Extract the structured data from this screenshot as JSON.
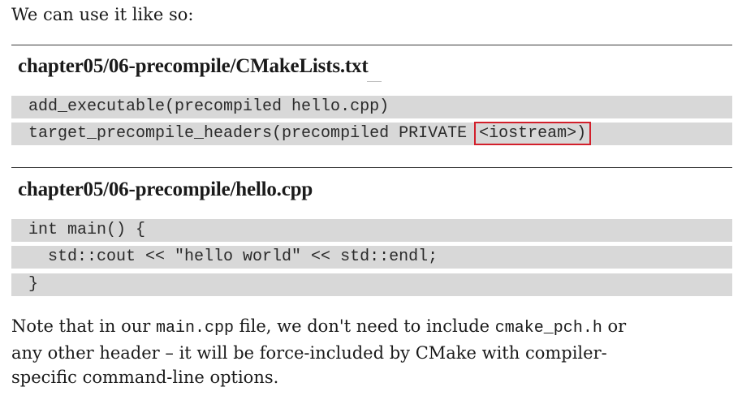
{
  "intro": "We can use it like so:",
  "section1": {
    "title": "chapter05/06-precompile/CMakeLists.txt",
    "lines": [
      "add_executable(precompiled hello.cpp)",
      "target_precompile_headers(precompiled PRIVATE "
    ],
    "highlight": "<iostream>)"
  },
  "section2": {
    "title": "chapter05/06-precompile/hello.cpp",
    "lines": [
      "int main() {",
      "  std::cout << \"hello world\" << std::endl;",
      "}"
    ]
  },
  "note": {
    "part1": "Note that in our ",
    "code1": "main.cpp",
    "part2": " file, we don't need to include ",
    "code2": "cmake_pch.h",
    "part3": " or any other header – it will be force-included by CMake with compiler-specific command-line options."
  },
  "colors": {
    "code_background": "#d8d8d8",
    "highlight_border": "#d21f2b"
  }
}
